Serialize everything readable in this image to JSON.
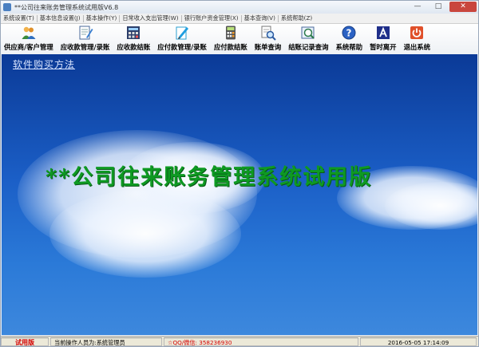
{
  "window": {
    "title": "**公司往来账务管理系统试用版V6.8",
    "controls": {
      "minimize": "—",
      "maximize": "□",
      "close": "✕"
    }
  },
  "menu": [
    "系统设置(T)",
    "基本信息设置(J)",
    "基本操作(Y)",
    "日常收入支出管理(W)",
    "银行账户资金管理(X)",
    "基本查询(V)",
    "系统帮助(Z)"
  ],
  "toolbar": {
    "buttons": [
      {
        "label": "供应商/客户管理",
        "icon": "people-icon"
      },
      {
        "label": "应收款管理/录账",
        "icon": "pen-document-icon"
      },
      {
        "label": "应收款结账",
        "icon": "calculator-grid-icon"
      },
      {
        "label": "应付款管理/录账",
        "icon": "pencil-document-icon"
      },
      {
        "label": "应付款结账",
        "icon": "calculator-icon"
      },
      {
        "label": "账单查询",
        "icon": "magnifier-document-icon"
      },
      {
        "label": "结账记录查询",
        "icon": "magnifier-list-icon"
      },
      {
        "label": "系统帮助",
        "icon": "help-icon"
      },
      {
        "label": "暂时离开",
        "icon": "leave-icon"
      },
      {
        "label": "退出系统",
        "icon": "power-icon"
      }
    ]
  },
  "workspace": {
    "buy_link": "软件购买方法",
    "big_title": "**公司往来账务管理系统试用版"
  },
  "status": {
    "trial": "试用版",
    "operator": "当前操作人员为:系统管理员",
    "qq": "☆QQ/微信: 358236930",
    "datetime": "2016-05-05  17:14:09"
  },
  "colors": {
    "title_green": "#0e9a22",
    "sky_top": "#0b3a97",
    "sky_bottom": "#3d88dd",
    "status_red": "#d40000"
  }
}
